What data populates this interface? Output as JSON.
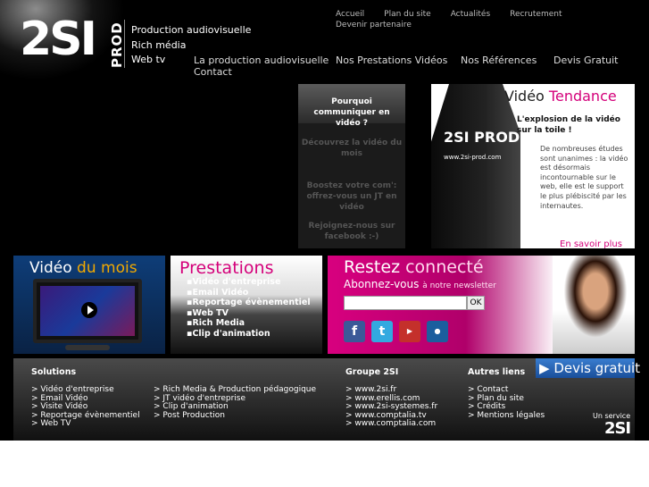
{
  "brand": {
    "logo_main": "2SI",
    "logo_sub": "PROD"
  },
  "tagline": [
    "Production audiovisuelle",
    "Rich média",
    "Web tv"
  ],
  "top_nav": [
    "Accueil",
    "Plan du site",
    "Actualités",
    "Recrutement",
    "Devenir partenaire"
  ],
  "main_nav": [
    "La production audiovisuelle",
    "Contact",
    "Nos Prestations Vidéos",
    "Nos Références",
    "Devis Gratuit"
  ],
  "featured_menu": [
    "Pourquoi communiquer en vidéo ?",
    "Découvrez la vidéo du mois",
    "Boostez votre com': offrez-vous un JT en vidéo",
    "Rejoignez-nous sur facebook :-)"
  ],
  "feature": {
    "title_1": "Vidéo ",
    "title_2": "Tendance",
    "subtitle": "L'explosion de la vidéo sur la toile !",
    "body": "De nombreuses études sont unanimes : la vidéo est désormais incontournable sur le web, elle est le support le plus plébiscité par les internautes.",
    "more": "En savoir plus",
    "shirt_logo": "2SI PROD",
    "shirt_url": "www.2si-prod.com"
  },
  "video_month": {
    "title_1": "Vidéo ",
    "title_2": "du mois"
  },
  "prestations": {
    "title": "Prestations",
    "items": [
      "Vidéo d'entreprise",
      "Email Vidéo",
      "Reportage évènementiel",
      "Web TV",
      "Rich Media",
      "Clip d'animation"
    ]
  },
  "connect": {
    "title_1": "Restez ",
    "title_2": "connecté",
    "sub_1": "Abonnez-vous ",
    "sub_2": "à notre newsletter",
    "input_value": "",
    "ok": "OK",
    "social": [
      "facebook-icon",
      "twitter-icon",
      "youtube-icon",
      "dailymotion-icon"
    ]
  },
  "footer": {
    "solutions": {
      "heading": "Solutions",
      "col1": [
        "Vidéo d'entreprise",
        "Email Vidéo",
        "Visite Vidéo",
        "Reportage évènementiel",
        "Web TV"
      ],
      "col2": [
        "Rich Media & Production pédagogique",
        "JT vidéo d'entreprise",
        "Clip d'animation",
        "Post Production"
      ]
    },
    "groupe": {
      "heading": "Groupe 2SI",
      "links": [
        "www.2si.fr",
        "www.erellis.com",
        "www.2si-systemes.fr",
        "www.comptalia.tv",
        "www.comptalia.com"
      ]
    },
    "autres": {
      "heading": "Autres liens",
      "links": [
        "Contact",
        "Plan du site",
        "Crédits",
        "Mentions légales"
      ]
    },
    "devis": "Devis gratuit",
    "service_label": "Un service",
    "service_brand": "2SI"
  }
}
